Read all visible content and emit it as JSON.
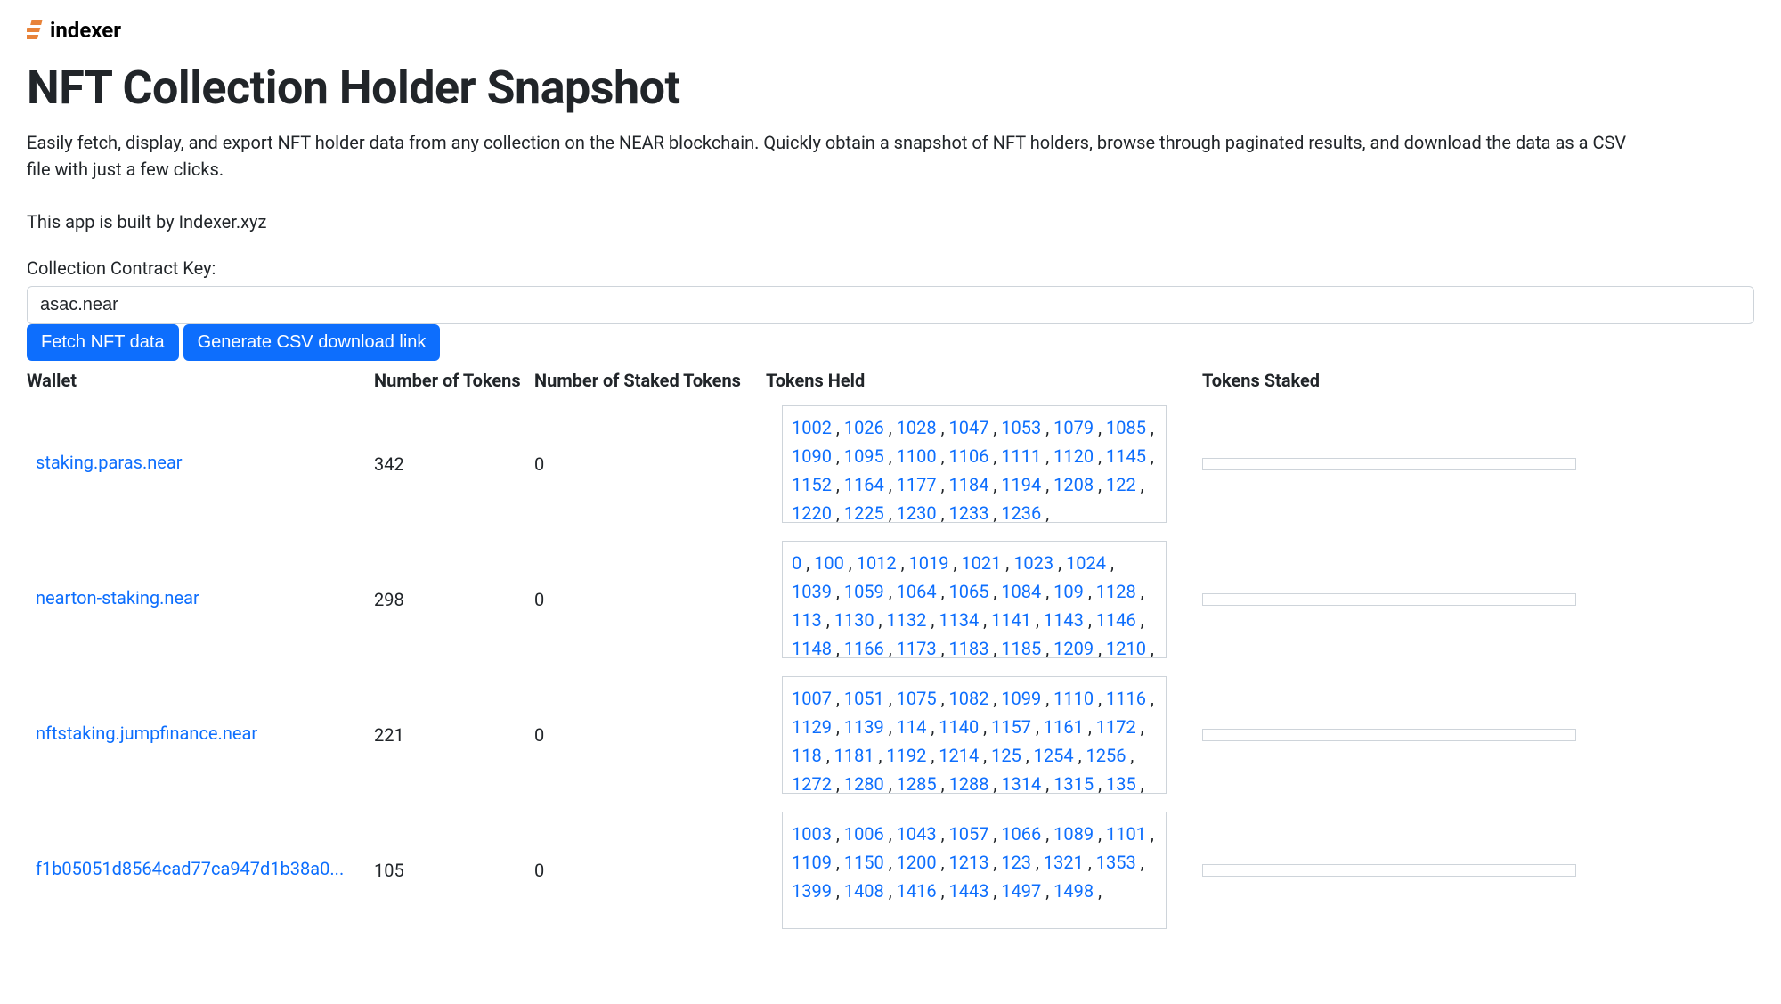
{
  "logo": {
    "text": "indexer"
  },
  "page": {
    "title": "NFT Collection Holder Snapshot",
    "description": "Easily fetch, display, and export NFT holder data from any collection on the NEAR blockchain. Quickly obtain a snapshot of NFT holders, browse through paginated results, and download the data as a CSV file with just a few clicks.",
    "built_by": "This app is built by Indexer.xyz"
  },
  "form": {
    "label": "Collection Contract Key:",
    "value": "asac.near",
    "fetch_label": "Fetch NFT data",
    "csv_label": "Generate CSV download link"
  },
  "table": {
    "headers": {
      "wallet": "Wallet",
      "num_tokens": "Number of Tokens",
      "num_staked": "Number of Staked Tokens",
      "tokens_held": "Tokens Held",
      "tokens_staked": "Tokens Staked"
    },
    "rows": [
      {
        "wallet": "staking.paras.near",
        "num_tokens": "342",
        "num_staked": "0",
        "tokens": [
          "1002",
          "1026",
          "1028",
          "1047",
          "1053",
          "1079",
          "1085",
          "1090",
          "1095",
          "1100",
          "1106",
          "1111",
          "1120",
          "1145",
          "1152",
          "1164",
          "1177",
          "1184",
          "1194",
          "1208",
          "122",
          "1220",
          "1225",
          "1230",
          "1233",
          "1236"
        ]
      },
      {
        "wallet": "nearton-staking.near",
        "num_tokens": "298",
        "num_staked": "0",
        "tokens": [
          "0",
          "100",
          "1012",
          "1019",
          "1021",
          "1023",
          "1024",
          "1039",
          "1059",
          "1064",
          "1065",
          "1084",
          "109",
          "1128",
          "113",
          "1130",
          "1132",
          "1134",
          "1141",
          "1143",
          "1146",
          "1148",
          "1166",
          "1173",
          "1183",
          "1185",
          "1209",
          "1210"
        ]
      },
      {
        "wallet": "nftstaking.jumpfinance.near",
        "num_tokens": "221",
        "num_staked": "0",
        "tokens": [
          "1007",
          "1051",
          "1075",
          "1082",
          "1099",
          "1110",
          "1116",
          "1129",
          "1139",
          "114",
          "1140",
          "1157",
          "1161",
          "1172",
          "118",
          "1181",
          "1192",
          "1214",
          "125",
          "1254",
          "1256",
          "1272",
          "1280",
          "1285",
          "1288",
          "1314",
          "1315",
          "135"
        ]
      },
      {
        "wallet": "f1b05051d8564cad77ca947d1b38a0...",
        "num_tokens": "105",
        "num_staked": "0",
        "tokens": [
          "1003",
          "1006",
          "1043",
          "1057",
          "1066",
          "1089",
          "1101",
          "1109",
          "1150",
          "1200",
          "1213",
          "123",
          "1321",
          "1353",
          "1399",
          "1408",
          "1416",
          "1443",
          "1497",
          "1498"
        ]
      }
    ]
  }
}
